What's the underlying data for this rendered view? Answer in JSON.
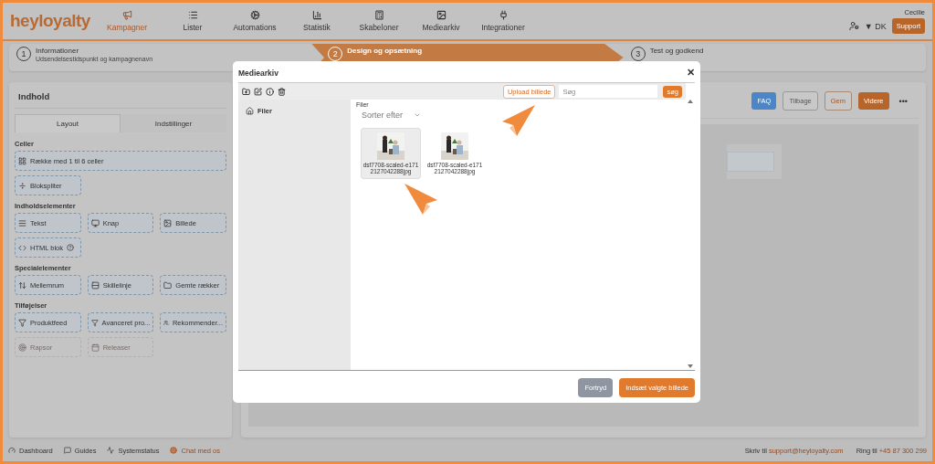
{
  "brand": {
    "logo": "heyloyalty"
  },
  "nav": [
    {
      "label": "Kampagner",
      "selected": true
    },
    {
      "label": "Lister",
      "selected": false
    },
    {
      "label": "Automations",
      "selected": false
    },
    {
      "label": "Statistik",
      "selected": false
    },
    {
      "label": "Skabeloner",
      "selected": false
    },
    {
      "label": "Mediearkiv",
      "selected": false
    },
    {
      "label": "Integrationer",
      "selected": false
    }
  ],
  "user": {
    "name": "Cecilie",
    "language": "▼ DK",
    "support": "Support"
  },
  "steps": [
    {
      "number": "1",
      "title": "Informationer",
      "subtitle": "Udsendelsestidspunkt og kampagnenavn",
      "selected": false
    },
    {
      "number": "2",
      "title": "Design og opsætning",
      "selected": true
    },
    {
      "number": "3",
      "title": "Test og godkend",
      "selected": false
    }
  ],
  "sidebar": {
    "title": "Indhold",
    "tabs": [
      {
        "label": "Layout",
        "selected": true
      },
      {
        "label": "Indstillinger",
        "selected": false
      }
    ],
    "sections": [
      {
        "title": "Celler",
        "items": [
          {
            "label": "Række med 1 til 6 celler",
            "wide": true,
            "disabled": false
          },
          {
            "label": "Blokspliter",
            "wide": false,
            "disabled": false
          }
        ]
      },
      {
        "title": "Indholdselementer",
        "items": [
          {
            "label": "Tekst",
            "wide": false,
            "disabled": false
          },
          {
            "label": "Knap",
            "wide": false,
            "disabled": false
          },
          {
            "label": "Billede",
            "wide": false,
            "disabled": false
          },
          {
            "label": "HTML blok",
            "wide": false,
            "help": true,
            "disabled": false
          }
        ]
      },
      {
        "title": "Specialelementer",
        "items": [
          {
            "label": "Mellemrum",
            "wide": false,
            "disabled": false
          },
          {
            "label": "Skillelinje",
            "wide": false,
            "disabled": false
          },
          {
            "label": "Gemte rækker",
            "wide": false,
            "disabled": false
          }
        ]
      },
      {
        "title": "Tilføjelser",
        "items": [
          {
            "label": "Produktfeed",
            "wide": false,
            "disabled": false
          },
          {
            "label": "Avanceret pro...",
            "wide": false,
            "disabled": false
          },
          {
            "label": "Rekommender...",
            "wide": false,
            "disabled": false
          },
          {
            "label": "Rapsor",
            "wide": false,
            "disabled": true
          },
          {
            "label": "Releaser",
            "wide": false,
            "disabled": true
          }
        ]
      }
    ]
  },
  "editor": {
    "buttons": [
      {
        "label": "FAQ",
        "kind": "info"
      },
      {
        "label": "Tilbage",
        "kind": "outline"
      },
      {
        "label": "Gem",
        "kind": "accent-outline"
      },
      {
        "label": "Videre",
        "kind": "primary"
      }
    ],
    "more": "•••"
  },
  "footer": {
    "links": [
      {
        "label": "Dashboard",
        "highlight": false
      },
      {
        "label": "Guides",
        "highlight": false
      },
      {
        "label": "Systemstatus",
        "highlight": false
      },
      {
        "label": "Chat med os",
        "highlight": true
      }
    ],
    "email_prefix": "Skriv til",
    "email": "support@heyloyalty.com",
    "phone_prefix": "Ring til",
    "phone": "+45 87 300 299"
  },
  "dialog": {
    "title": "Mediearkiv",
    "close": "✕",
    "upload": "Upload billede",
    "search_placeholder": "Søg",
    "search_button": "søg",
    "folders": [
      {
        "label": "Filer",
        "selected": true
      }
    ],
    "filter_label": "Filer",
    "sort": "Sorter efter",
    "files": [
      {
        "kind": "picture",
        "name": "dsf7708-scaled-e1712127042288jpg",
        "selected": true
      },
      {
        "kind": "picture",
        "name": "dsf7708-scaled-e1712127042288jpg",
        "selected": false
      }
    ],
    "cancel": "Fortryd",
    "insert": "Indsæt valgte billede"
  }
}
